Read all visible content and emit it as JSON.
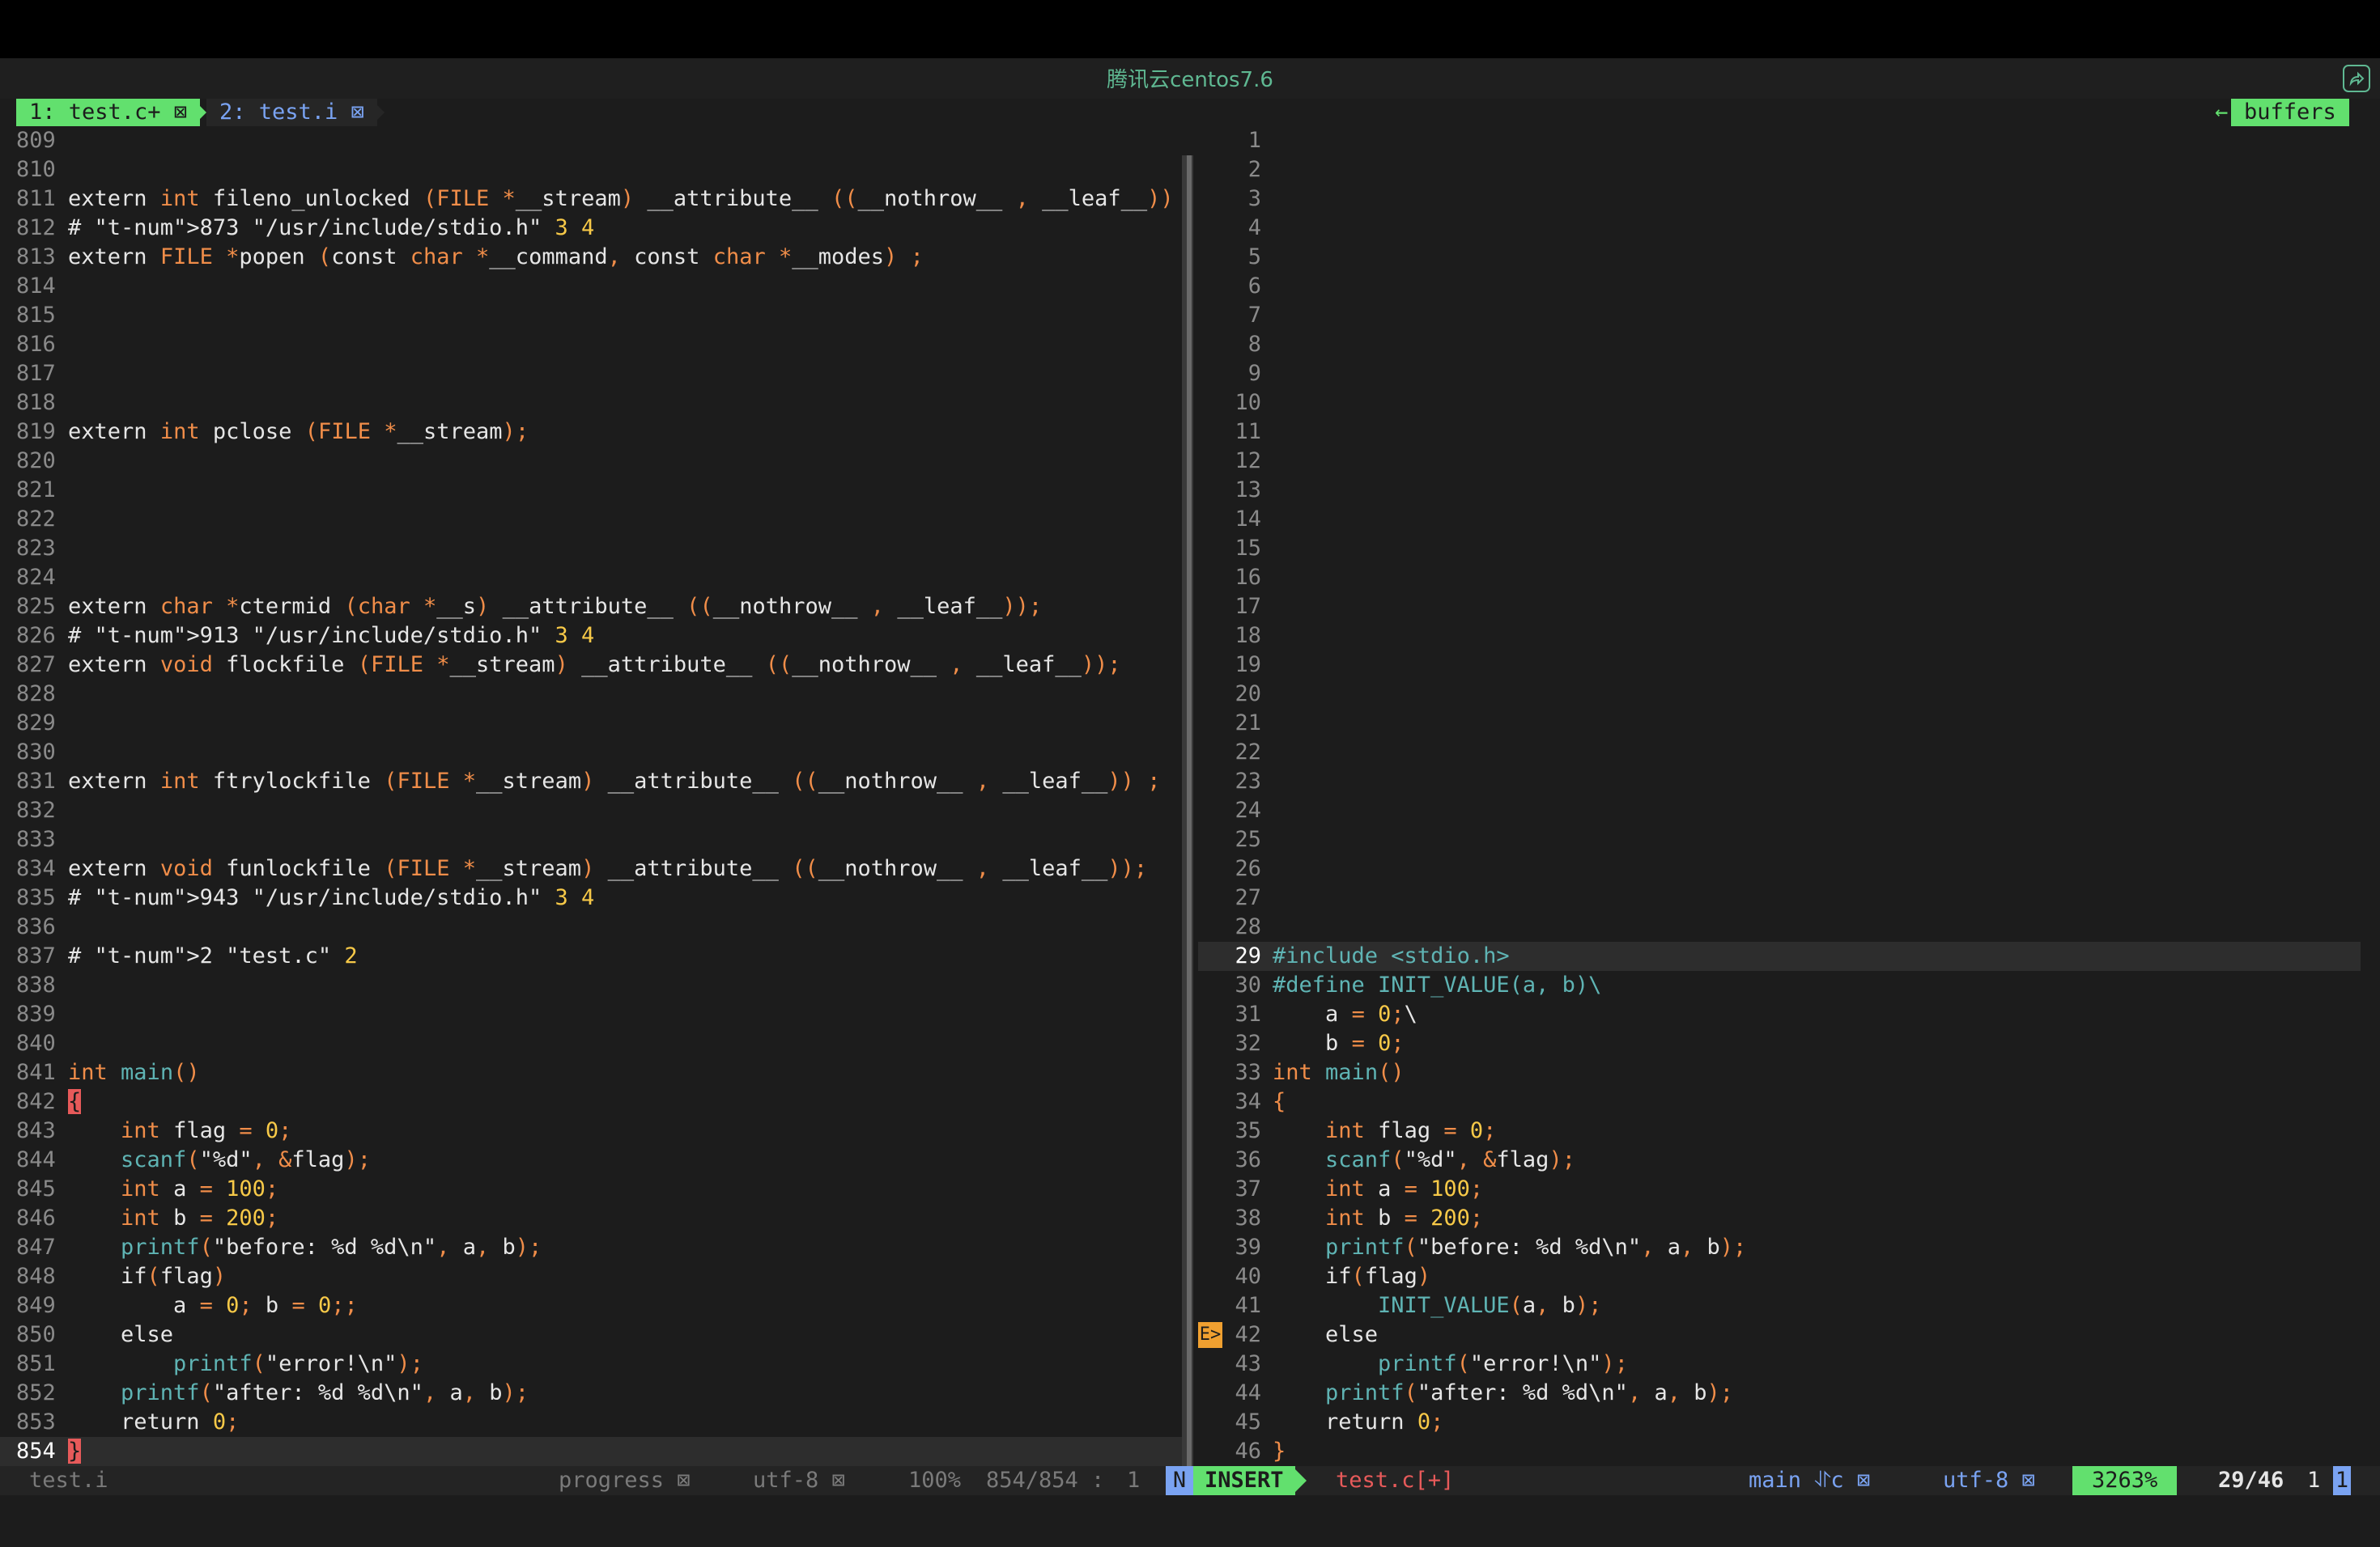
{
  "window": {
    "title": "腾讯云centos7.6"
  },
  "tabline": {
    "tab1": "1: test.c+ ⊠",
    "tab2": "2: test.i ⊠",
    "buffers_sep": "←",
    "buffers": "buffers"
  },
  "left_pane": {
    "lines": [
      {
        "n": "809",
        "code": ""
      },
      {
        "n": "810",
        "code": ""
      },
      {
        "n": "811",
        "code": "extern int fileno_unlocked (FILE *__stream) __attribute__ ((__nothrow__ , __leaf__)) ;"
      },
      {
        "n": "812",
        "code": "# 873 \"/usr/include/stdio.h\" 3 4"
      },
      {
        "n": "813",
        "code": "extern FILE *popen (const char *__command, const char *__modes) ;"
      },
      {
        "n": "814",
        "code": ""
      },
      {
        "n": "815",
        "code": ""
      },
      {
        "n": "816",
        "code": ""
      },
      {
        "n": "817",
        "code": ""
      },
      {
        "n": "818",
        "code": ""
      },
      {
        "n": "819",
        "code": "extern int pclose (FILE *__stream);"
      },
      {
        "n": "820",
        "code": ""
      },
      {
        "n": "821",
        "code": ""
      },
      {
        "n": "822",
        "code": ""
      },
      {
        "n": "823",
        "code": ""
      },
      {
        "n": "824",
        "code": ""
      },
      {
        "n": "825",
        "code": "extern char *ctermid (char *__s) __attribute__ ((__nothrow__ , __leaf__));"
      },
      {
        "n": "826",
        "code": "# 913 \"/usr/include/stdio.h\" 3 4"
      },
      {
        "n": "827",
        "code": "extern void flockfile (FILE *__stream) __attribute__ ((__nothrow__ , __leaf__));"
      },
      {
        "n": "828",
        "code": ""
      },
      {
        "n": "829",
        "code": ""
      },
      {
        "n": "830",
        "code": ""
      },
      {
        "n": "831",
        "code": "extern int ftrylockfile (FILE *__stream) __attribute__ ((__nothrow__ , __leaf__)) ;"
      },
      {
        "n": "832",
        "code": ""
      },
      {
        "n": "833",
        "code": ""
      },
      {
        "n": "834",
        "code": "extern void funlockfile (FILE *__stream) __attribute__ ((__nothrow__ , __leaf__));"
      },
      {
        "n": "835",
        "code": "# 943 \"/usr/include/stdio.h\" 3 4"
      },
      {
        "n": "836",
        "code": ""
      },
      {
        "n": "837",
        "code": "# 2 \"test.c\" 2"
      },
      {
        "n": "838",
        "code": ""
      },
      {
        "n": "839",
        "code": ""
      },
      {
        "n": "840",
        "code": ""
      },
      {
        "n": "841",
        "code": "int main()"
      },
      {
        "n": "842",
        "code": "{"
      },
      {
        "n": "843",
        "code": "    int flag = 0;"
      },
      {
        "n": "844",
        "code": "    scanf(\"%d\", &flag);"
      },
      {
        "n": "845",
        "code": "    int a = 100;"
      },
      {
        "n": "846",
        "code": "    int b = 200;"
      },
      {
        "n": "847",
        "code": "    printf(\"before: %d %d\\n\", a, b);"
      },
      {
        "n": "848",
        "code": "    if(flag)"
      },
      {
        "n": "849",
        "code": "        a = 0; b = 0;;"
      },
      {
        "n": "850",
        "code": "    else"
      },
      {
        "n": "851",
        "code": "        printf(\"error!\\n\");"
      },
      {
        "n": "852",
        "code": "    printf(\"after: %d %d\\n\", a, b);"
      },
      {
        "n": "853",
        "code": "    return 0;"
      },
      {
        "n": "854",
        "code": "}"
      }
    ]
  },
  "right_pane": {
    "lines": [
      {
        "n": "1",
        "code": ""
      },
      {
        "n": "2",
        "code": ""
      },
      {
        "n": "3",
        "code": ""
      },
      {
        "n": "4",
        "code": ""
      },
      {
        "n": "5",
        "code": ""
      },
      {
        "n": "6",
        "code": ""
      },
      {
        "n": "7",
        "code": ""
      },
      {
        "n": "8",
        "code": ""
      },
      {
        "n": "9",
        "code": ""
      },
      {
        "n": "10",
        "code": ""
      },
      {
        "n": "11",
        "code": ""
      },
      {
        "n": "12",
        "code": ""
      },
      {
        "n": "13",
        "code": ""
      },
      {
        "n": "14",
        "code": ""
      },
      {
        "n": "15",
        "code": ""
      },
      {
        "n": "16",
        "code": ""
      },
      {
        "n": "17",
        "code": ""
      },
      {
        "n": "18",
        "code": ""
      },
      {
        "n": "19",
        "code": ""
      },
      {
        "n": "20",
        "code": ""
      },
      {
        "n": "21",
        "code": ""
      },
      {
        "n": "22",
        "code": ""
      },
      {
        "n": "23",
        "code": ""
      },
      {
        "n": "24",
        "code": ""
      },
      {
        "n": "25",
        "code": ""
      },
      {
        "n": "26",
        "code": ""
      },
      {
        "n": "27",
        "code": ""
      },
      {
        "n": "28",
        "code": ""
      },
      {
        "n": "29",
        "code": "#include <stdio.h>"
      },
      {
        "n": "30",
        "code": "#define INIT_VALUE(a, b)\\"
      },
      {
        "n": "31",
        "code": "    a = 0;\\"
      },
      {
        "n": "32",
        "code": "    b = 0;"
      },
      {
        "n": "33",
        "code": "int main()"
      },
      {
        "n": "34",
        "code": "{"
      },
      {
        "n": "35",
        "code": "    int flag = 0;"
      },
      {
        "n": "36",
        "code": "    scanf(\"%d\", &flag);"
      },
      {
        "n": "37",
        "code": "    int a = 100;"
      },
      {
        "n": "38",
        "code": "    int b = 200;"
      },
      {
        "n": "39",
        "code": "    printf(\"before: %d %d\\n\", a, b);"
      },
      {
        "n": "40",
        "code": "    if(flag)"
      },
      {
        "n": "41",
        "code": "        INIT_VALUE(a, b);"
      },
      {
        "n": "42",
        "code": "    else"
      },
      {
        "n": "43",
        "code": "        printf(\"error!\\n\");"
      },
      {
        "n": "44",
        "code": "    printf(\"after: %d %d\\n\", a, b);"
      },
      {
        "n": "45",
        "code": "    return 0;"
      },
      {
        "n": "46",
        "code": "}"
      }
    ],
    "sign": "E>"
  },
  "statusline": {
    "left_file": "test.i",
    "progress": "progress ⊠",
    "enc_left": "utf-8 ⊠",
    "pct_left": "100%",
    "pos_left": "854/854 :",
    "col_left": "1",
    "mode_n": "N",
    "mode": "INSERT",
    "file": "test.c[+]",
    "branch": "main ⥯c ⊠",
    "enc_right": "utf-8 ⊠",
    "pct_right": "3263%",
    "pos_right": "29/46",
    "col_right": "1",
    "end": "1"
  }
}
